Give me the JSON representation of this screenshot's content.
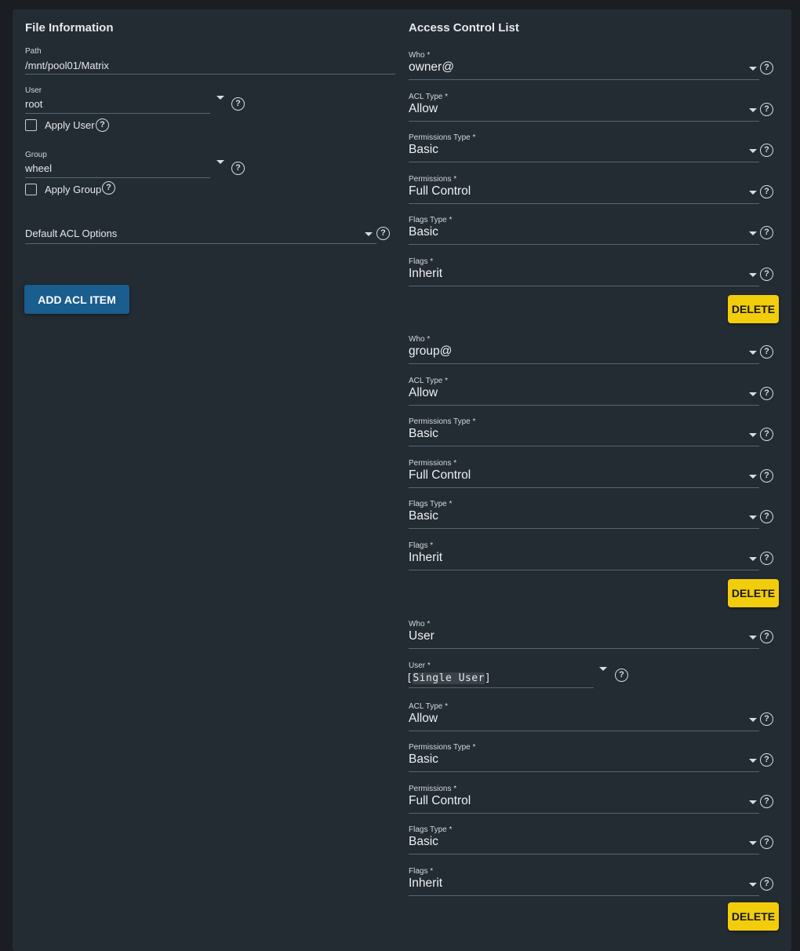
{
  "file_info": {
    "title": "File Information",
    "path_label": "Path",
    "path_value": "/mnt/pool01/Matrix",
    "user_label": "User",
    "user_value": "root",
    "apply_user_label": "Apply User",
    "group_label": "Group",
    "group_value": "wheel",
    "apply_group_label": "Apply Group",
    "default_acl_label": "Default ACL Options",
    "add_button": "ADD ACL ITEM"
  },
  "acl": {
    "title": "Access Control List",
    "delete_label": "DELETE",
    "help_glyph": "?",
    "items": [
      {
        "who_label": "Who *",
        "who": "owner@",
        "acl_type_label": "ACL Type *",
        "acl_type": "Allow",
        "perm_type_label": "Permissions Type *",
        "perm_type": "Basic",
        "perms_label": "Permissions *",
        "perms": "Full Control",
        "flags_type_label": "Flags Type *",
        "flags_type": "Basic",
        "flags_label": "Flags *",
        "flags": "Inherit"
      },
      {
        "who_label": "Who *",
        "who": "group@",
        "acl_type_label": "ACL Type *",
        "acl_type": "Allow",
        "perm_type_label": "Permissions Type *",
        "perm_type": "Basic",
        "perms_label": "Permissions *",
        "perms": "Full Control",
        "flags_type_label": "Flags Type *",
        "flags_type": "Basic",
        "flags_label": "Flags *",
        "flags": "Inherit"
      },
      {
        "who_label": "Who *",
        "who": "User",
        "user_label": "User *",
        "user_bracket_open": "[",
        "user_value": "Single User",
        "user_bracket_close": "]",
        "acl_type_label": "ACL Type *",
        "acl_type": "Allow",
        "perm_type_label": "Permissions Type *",
        "perm_type": "Basic",
        "perms_label": "Permissions *",
        "perms": "Full Control",
        "flags_type_label": "Flags Type *",
        "flags_type": "Basic",
        "flags_label": "Flags *",
        "flags": "Inherit"
      }
    ]
  }
}
